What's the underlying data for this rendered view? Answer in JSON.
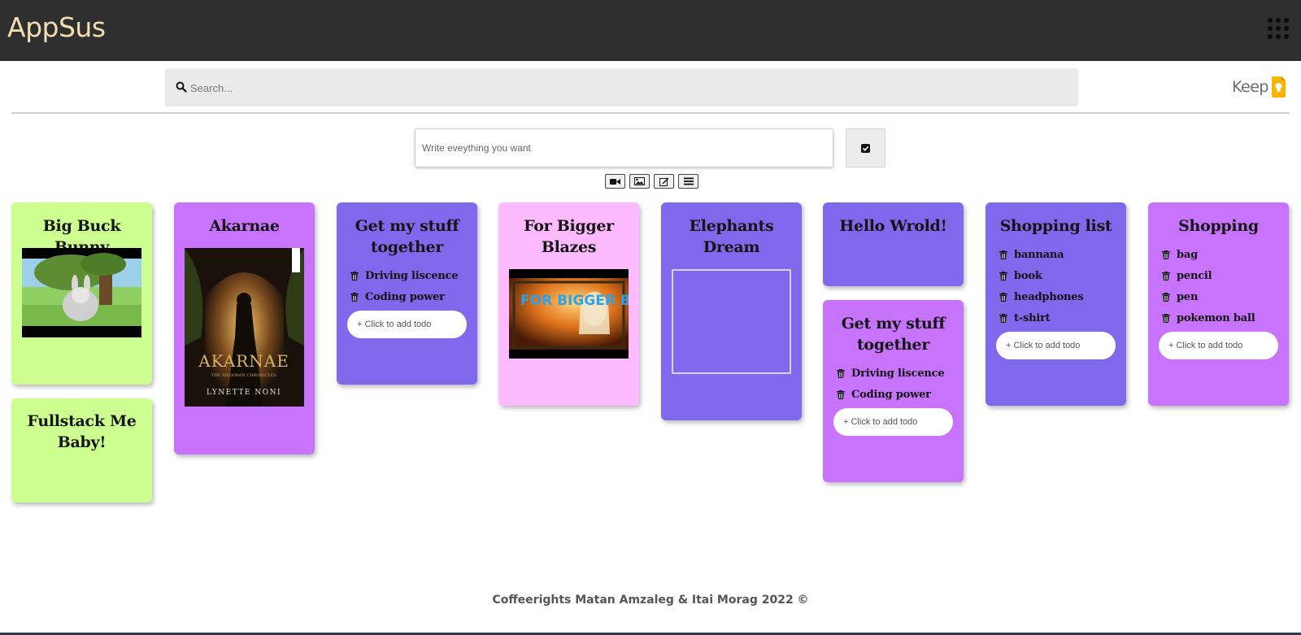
{
  "header": {
    "logo": "AppSus",
    "apps_icon": "grid-icon"
  },
  "search": {
    "placeholder": "Search...",
    "icon": "search-icon"
  },
  "keep_logo": {
    "text": "Keep",
    "icon": "keep-bulb-icon"
  },
  "composer": {
    "placeholder": "Write eveything you want",
    "submit_icon": "checkbox-icon",
    "type_buttons": [
      "video-icon",
      "image-icon",
      "edit-icon",
      "list-icon"
    ]
  },
  "notes": [
    {
      "title": "Big Buck Bunny",
      "type": "video",
      "color": "#ccff90"
    },
    {
      "title": "Fullstack Me Baby!",
      "type": "text",
      "color": "#ccff90"
    },
    {
      "title": "Akarnae",
      "type": "image",
      "color": "#c873fb",
      "book": {
        "title": "AKARNAE",
        "subtitle": "THE MEDORAN CHRONICLES",
        "author": "LYNETTE NONI"
      }
    },
    {
      "title": "Get my stuff together",
      "type": "todos",
      "color": "#8068ed",
      "todos": [
        "Driving liscence",
        "Coding power"
      ],
      "add_label": "+ Click to add todo"
    },
    {
      "title": "For Bigger Blazes",
      "type": "video",
      "color": "#fdbafe",
      "thumb_text": "FOR BIGGER BLAZES"
    },
    {
      "title": "Elephants Dream",
      "type": "video",
      "color": "#8068ed"
    },
    {
      "title": "Hello Wrold!",
      "type": "text",
      "color": "#8068ed"
    },
    {
      "title": "Get my stuff together",
      "type": "todos",
      "color": "#c873fb",
      "todos": [
        "Driving liscence",
        "Coding power"
      ],
      "add_label": "+ Click to add todo"
    },
    {
      "title": "Shopping list",
      "type": "todos",
      "color": "#8068ed",
      "todos": [
        "bannana",
        "book",
        "headphones",
        "t-shirt"
      ],
      "add_label": "+ Click to add todo"
    },
    {
      "title": "Shopping",
      "type": "todos",
      "color": "#c873fb",
      "todos": [
        "bag",
        "pencil",
        "pen",
        "pokemon ball"
      ],
      "add_label": "+ Click to add todo"
    }
  ],
  "footer": {
    "text": "Coffeerights Matan Amzaleg & Itai Morag 2022 ©"
  }
}
